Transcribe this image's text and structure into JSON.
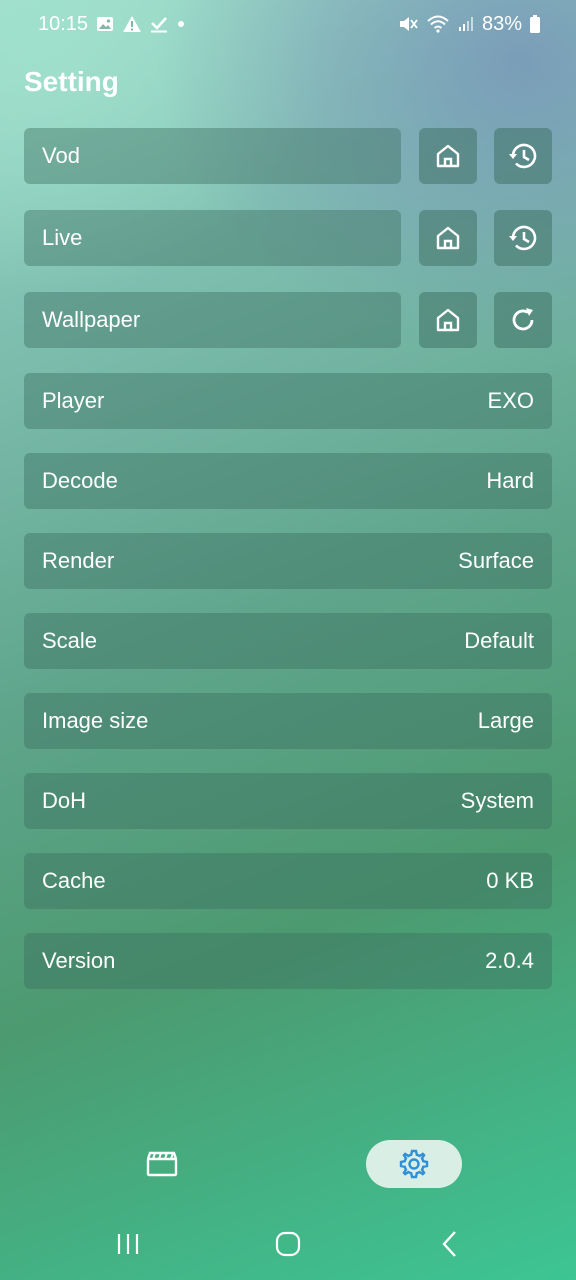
{
  "status_bar": {
    "time": "10:15",
    "battery": "83%",
    "left_icons": [
      "image-icon",
      "warning-icon",
      "check-icon",
      "dot-icon"
    ],
    "right_icons": [
      "mute-icon",
      "wifi-icon",
      "signal-icon",
      "battery-icon"
    ]
  },
  "page": {
    "title": "Setting"
  },
  "source_rows": [
    {
      "label": "Vod",
      "actions": [
        "home-icon",
        "history-icon"
      ]
    },
    {
      "label": "Live",
      "actions": [
        "home-icon",
        "history-icon"
      ]
    },
    {
      "label": "Wallpaper",
      "actions": [
        "home-icon",
        "refresh-icon"
      ]
    }
  ],
  "settings": [
    {
      "label": "Player",
      "value": "EXO"
    },
    {
      "label": "Decode",
      "value": "Hard"
    },
    {
      "label": "Render",
      "value": "Surface"
    },
    {
      "label": "Scale",
      "value": "Default"
    },
    {
      "label": "Image size",
      "value": "Large"
    },
    {
      "label": "DoH",
      "value": "System"
    },
    {
      "label": "Cache",
      "value": "0 KB"
    },
    {
      "label": "Version",
      "value": "2.0.4"
    }
  ],
  "bottom_nav": {
    "items": [
      "film-icon",
      "settings-gear-icon"
    ],
    "active": "settings-gear-icon",
    "active_color": "#2f8fd8"
  },
  "system_nav": [
    "recent-apps-icon",
    "home-button-icon",
    "back-icon"
  ]
}
